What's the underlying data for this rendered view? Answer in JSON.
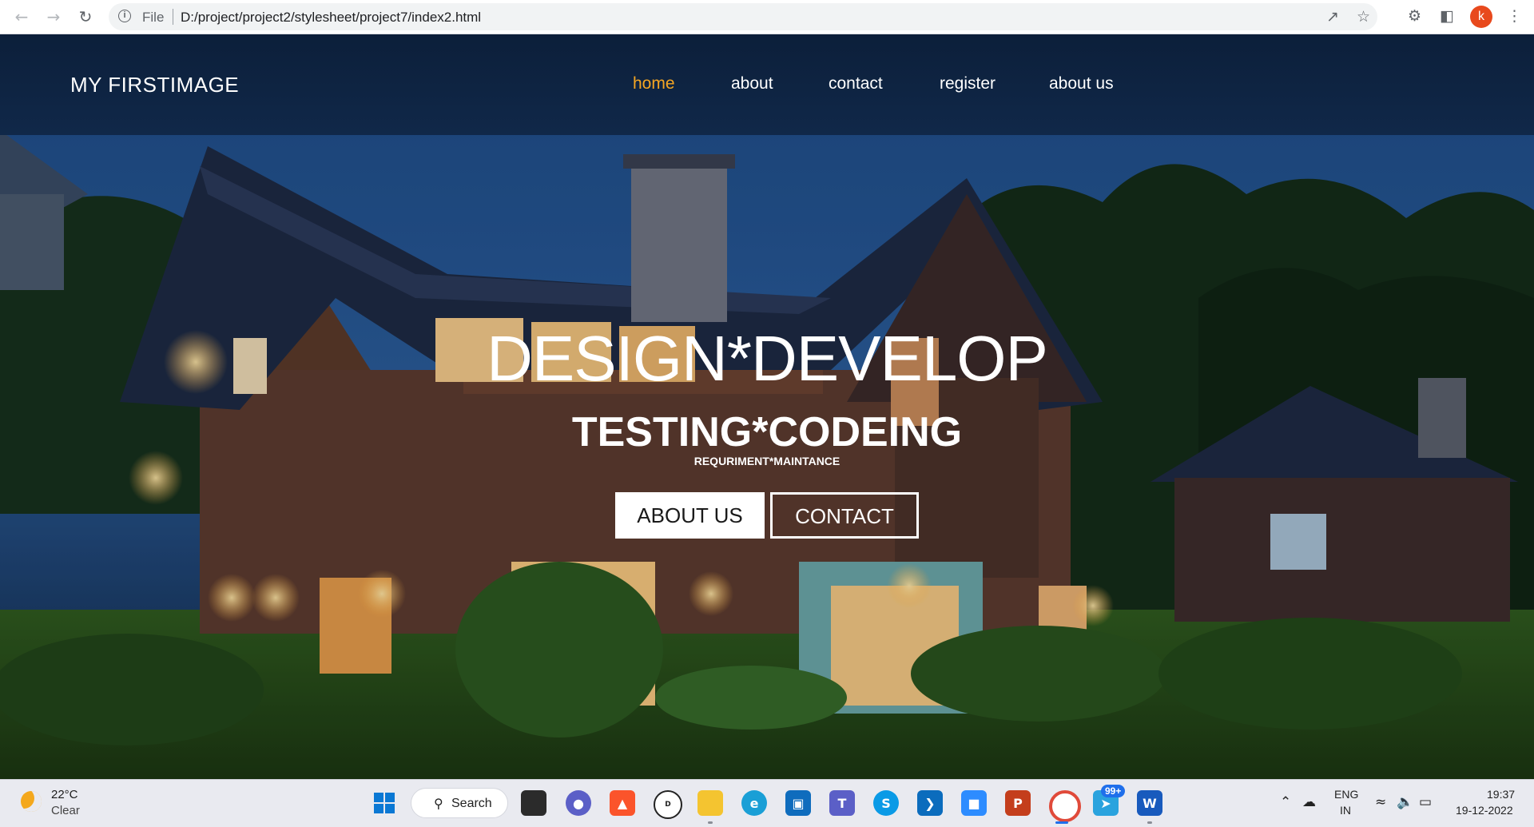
{
  "browser": {
    "back_icon": "arrow-left-icon",
    "forward_icon": "arrow-right-icon",
    "reload_icon": "reload-icon",
    "url_scheme_label": "File",
    "url": "D:/project/project2/stylesheet/project7/index2.html",
    "profile_initial": "k"
  },
  "site": {
    "logo": "MY FIRSTIMAGE",
    "menu": [
      {
        "label": "home",
        "active": true
      },
      {
        "label": "about",
        "active": false
      },
      {
        "label": "contact",
        "active": false
      },
      {
        "label": "register",
        "active": false
      },
      {
        "label": "about us",
        "active": false
      }
    ],
    "menu_active_color": "#f5a623",
    "header_color": "#0c1f3a"
  },
  "hero": {
    "title": "DESIGN*DEVELOP",
    "subtitle": "TESTING*CODEING",
    "tagline": "REQURIMENT*MAINTANCE",
    "buttons": {
      "about": "ABOUT US",
      "contact": "CONTACT"
    }
  },
  "taskbar": {
    "weather_temp": "22°C",
    "weather_condition": "Clear",
    "search_label": "Search",
    "notification_badge": "99+",
    "language_line1": "ENG",
    "language_line2": "IN",
    "time": "19:37",
    "date": "19-12-2022"
  }
}
